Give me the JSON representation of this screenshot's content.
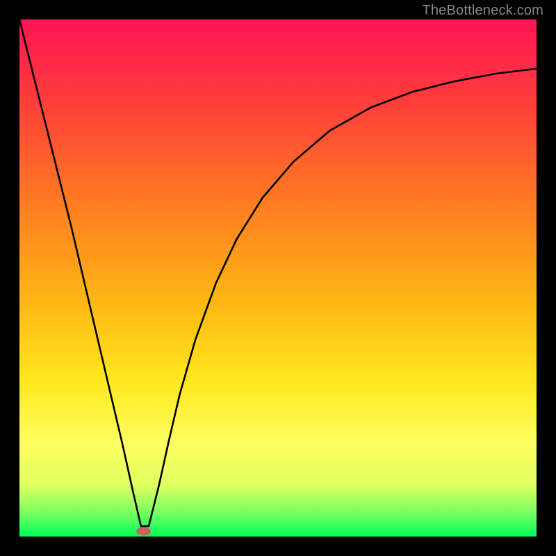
{
  "watermark": "TheBottleneck.com",
  "chart_data": {
    "type": "line",
    "title": "",
    "xlabel": "",
    "ylabel": "",
    "xlim": [
      0,
      100
    ],
    "ylim": [
      0,
      100
    ],
    "gradient_stops": [
      {
        "offset": 0,
        "color": "#ff1456"
      },
      {
        "offset": 15,
        "color": "#ff3b3b"
      },
      {
        "offset": 35,
        "color": "#ff7a22"
      },
      {
        "offset": 55,
        "color": "#ffb814"
      },
      {
        "offset": 70,
        "color": "#ffe81e"
      },
      {
        "offset": 82,
        "color": "#ffff60"
      },
      {
        "offset": 90,
        "color": "#e0ff60"
      },
      {
        "offset": 95,
        "color": "#80ff60"
      },
      {
        "offset": 100,
        "color": "#00ff5a"
      }
    ],
    "series": [
      {
        "name": "bottleneck-curve",
        "x": [
          0.0,
          2.0,
          4.0,
          6.0,
          8.0,
          10.0,
          12.0,
          14.0,
          16.0,
          18.0,
          20.0,
          22.0,
          23.5,
          25.0,
          27.0,
          29.0,
          31.0,
          34.0,
          38.0,
          42.0,
          47.0,
          53.0,
          60.0,
          68.0,
          76.0,
          84.0,
          92.0,
          100.0
        ],
        "values": [
          100.0,
          92.0,
          84.0,
          76.0,
          68.0,
          60.0,
          51.5,
          43.0,
          34.5,
          26.0,
          17.5,
          8.5,
          2.0,
          2.0,
          10.0,
          19.0,
          27.5,
          38.0,
          49.0,
          57.5,
          65.5,
          72.5,
          78.5,
          83.0,
          86.0,
          88.0,
          89.5,
          90.5
        ]
      }
    ],
    "marker": {
      "x": 24.0,
      "y": 1.0,
      "rx": 1.4,
      "ry": 0.8
    }
  }
}
